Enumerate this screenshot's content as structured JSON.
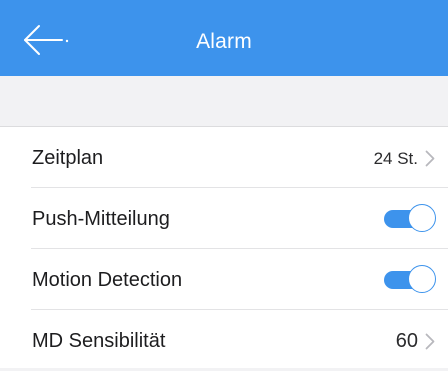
{
  "header": {
    "title": "Alarm",
    "back_icon": "arrow-left-icon",
    "background_color": "#3d93ec"
  },
  "settings": {
    "schedule": {
      "label": "Zeitplan",
      "value": "24 St.",
      "icon": "chevron-right-icon"
    },
    "push_notification": {
      "label": "Push-Mitteilung",
      "enabled": true
    },
    "motion_detection": {
      "label": "Motion Detection",
      "enabled": true
    },
    "md_sensitivity": {
      "label": "MD Sensibilität",
      "value": "60",
      "icon": "chevron-right-icon"
    }
  },
  "colors": {
    "accent": "#3d93ec",
    "background": "#f2f2f4",
    "row_background": "#ffffff"
  }
}
